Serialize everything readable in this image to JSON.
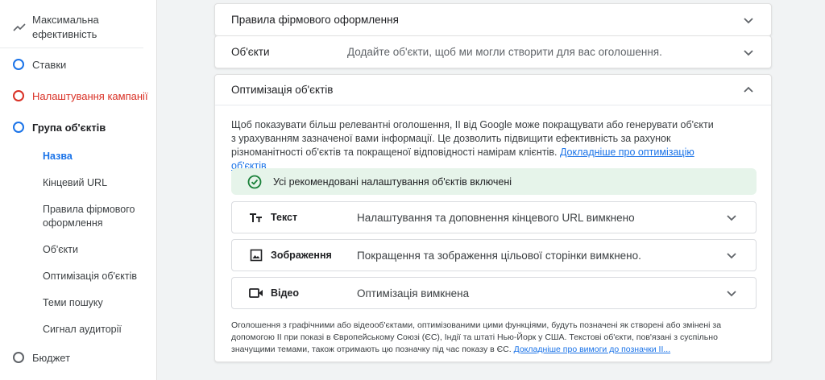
{
  "sidebar": {
    "top_item": "Максимальна ефективність",
    "items": [
      {
        "label": "Ставки"
      },
      {
        "label": "Налаштування кампанії"
      },
      {
        "label": "Група об'єктів"
      },
      {
        "label": "Бюджет"
      }
    ],
    "sub_items": [
      {
        "label": "Назва"
      },
      {
        "label": "Кінцевий URL"
      },
      {
        "label": "Правила фірмового оформлення"
      },
      {
        "label": "Об'єкти"
      },
      {
        "label": "Оптимізація об'єктів"
      },
      {
        "label": "Теми пошуку"
      },
      {
        "label": "Сигнал аудиторії"
      }
    ]
  },
  "main": {
    "brand_rules": {
      "title": "Правила фірмового оформлення"
    },
    "assets": {
      "title": "Об'єкти",
      "desc": "Додайте об'єкти, щоб ми могли створити для вас оголошення."
    },
    "optimization": {
      "title": "Оптимізація об'єктів",
      "desc": "Щоб показувати більш релевантні оголошення, ІІ від Google може покращувати або генерувати об'єкти з урахуванням зазначеної вами інформації. Це дозволить підвищити ефективність за рахунок різноманітності об'єктів та покращеної відповідності намірам клієнтів.",
      "desc_link": "Докладніше про оптимізацію об'єктів",
      "banner": "Усі рекомендовані налаштування об'єктів включені",
      "rows": [
        {
          "icon": "text-format-icon",
          "label": "Текст",
          "desc": "Налаштування та доповнення кінцевого URL вимкнено"
        },
        {
          "icon": "image-icon",
          "label": "Зображення",
          "desc": "Покращення та зображення цільової сторінки вимкнено."
        },
        {
          "icon": "video-icon",
          "label": "Відео",
          "desc": "Оптимізація вимкнена"
        }
      ],
      "footnote": "Оголошення з графічними або відеооб'єктами, оптимізованими цими функціями, будуть позначені як створені або змінені за допомогою ІІ при показі в Європейському Союзі (ЄС), Індії та штаті Нью-Йорк у США. Текстові об'єкти, пов'язані з суспільно значущими темами, також отримають цю позначку під час показу в ЄС.",
      "footnote_link": "Докладніше про вимоги до позначки ІІ..."
    }
  },
  "colors": {
    "accent": "#1a73e8",
    "error": "#d93025",
    "success_bg": "#e6f4ea",
    "success": "#188038"
  }
}
